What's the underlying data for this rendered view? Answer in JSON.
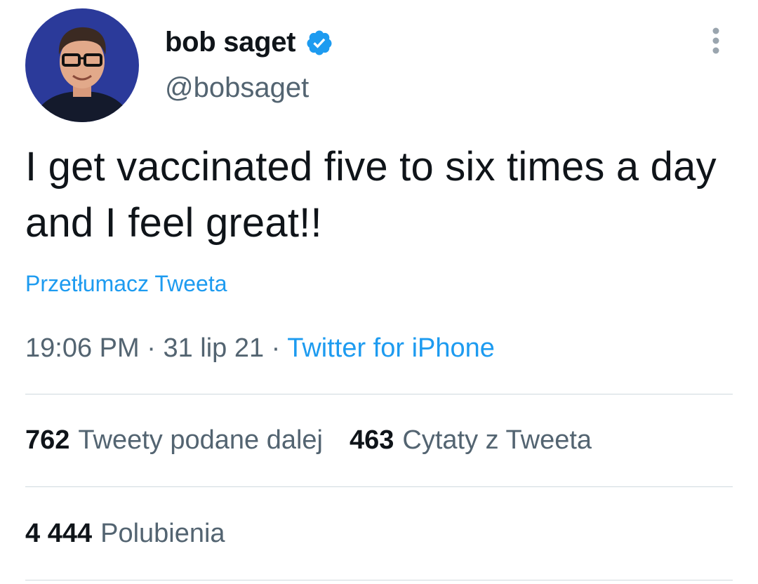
{
  "author": {
    "display_name": "bob saget",
    "handle": "@bobsaget",
    "verified": true,
    "avatar_icon": "profile-photo"
  },
  "menu": {
    "icon": "more-vertical-icon"
  },
  "tweet": {
    "text": "I get vaccinated five to six times a day and I feel great!!",
    "translate_label": "Przetłumacz Tweeta"
  },
  "meta": {
    "time": "19:06 PM",
    "separator": "·",
    "date": "31 lip 21",
    "source": "Twitter for iPhone"
  },
  "stats": {
    "retweets": {
      "count": "762",
      "label": "Tweety podane dalej"
    },
    "quotes": {
      "count": "463",
      "label": "Cytaty z Tweeta"
    },
    "likes": {
      "count": "4 444",
      "label": "Polubienia"
    }
  },
  "colors": {
    "link": "#1d9bf0",
    "secondary_text": "#536471",
    "primary_text": "#0f1419",
    "divider": "#cfd9de",
    "avatar_background": "#2b3a9a"
  }
}
